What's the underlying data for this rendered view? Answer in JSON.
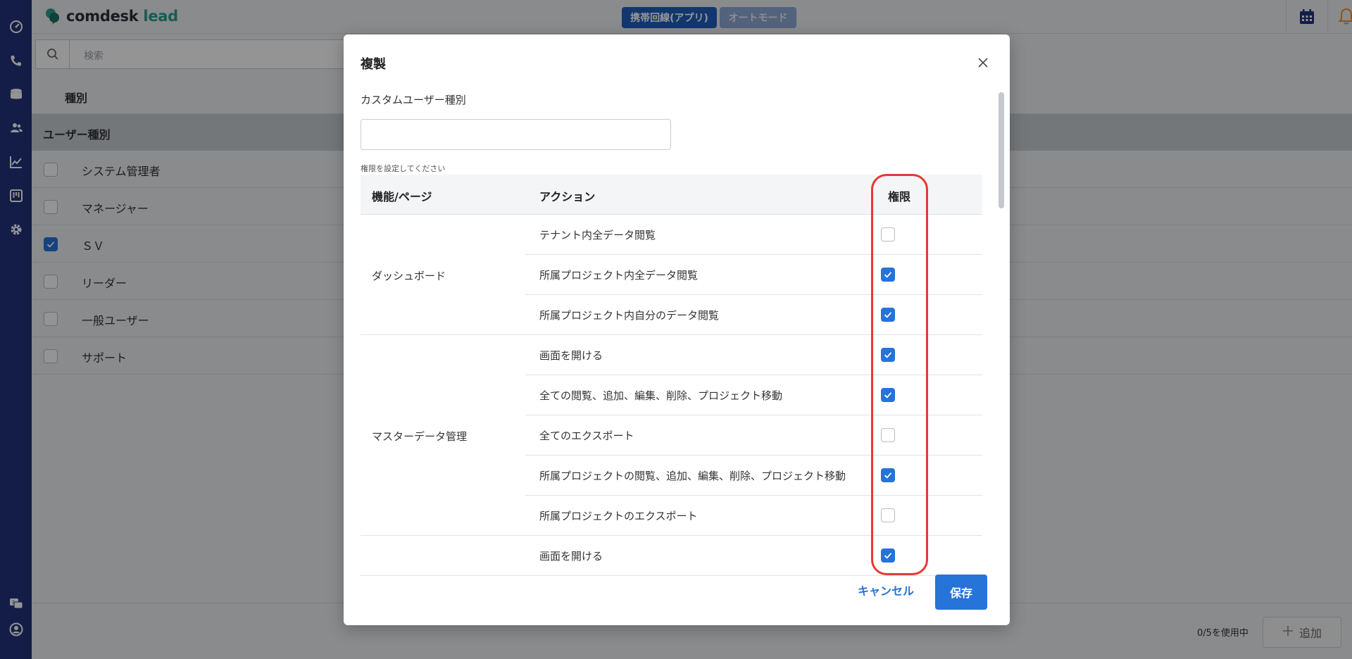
{
  "app": {
    "logo_brand": "comdesk",
    "logo_suffix": "lead"
  },
  "topbar": {
    "mode_primary": "携帯回線(アプリ)",
    "mode_secondary": "オートモード"
  },
  "search": {
    "placeholder": "検索"
  },
  "page": {
    "tab_label": "種別",
    "list_header": "ユーザー種別",
    "rows": [
      {
        "label": "システム管理者",
        "checked": false
      },
      {
        "label": "マネージャー",
        "checked": false
      },
      {
        "label": "ＳＶ",
        "checked": true
      },
      {
        "label": "リーダー",
        "checked": false
      },
      {
        "label": "一般ユーザー",
        "checked": false
      },
      {
        "label": "サポート",
        "checked": false
      }
    ],
    "usage": "0/5を使用中",
    "add_label": "追加"
  },
  "modal": {
    "title": "複製",
    "field_label": "カスタムユーザー種別",
    "field_value": "",
    "hint": "権限を設定してください",
    "columns": [
      "機能/ページ",
      "アクション",
      "権限"
    ],
    "groups": [
      {
        "name": "ダッシュボード",
        "actions": [
          {
            "label": "テナント内全データ閲覧",
            "checked": false
          },
          {
            "label": "所属プロジェクト内全データ閲覧",
            "checked": true
          },
          {
            "label": "所属プロジェクト内自分のデータ閲覧",
            "checked": true
          }
        ]
      },
      {
        "name": "マスターデータ管理",
        "actions": [
          {
            "label": "画面を開ける",
            "checked": true
          },
          {
            "label": "全ての閲覧、追加、編集、削除、プロジェクト移動",
            "checked": true
          },
          {
            "label": "全てのエクスポート",
            "checked": false
          },
          {
            "label": "所属プロジェクトの閲覧、追加、編集、削除、プロジェクト移動",
            "checked": true
          },
          {
            "label": "所属プロジェクトのエクスポート",
            "checked": false
          }
        ]
      },
      {
        "name": "",
        "actions": [
          {
            "label": "画面を開ける",
            "checked": true
          }
        ]
      }
    ],
    "cancel_label": "キャンセル",
    "save_label": "保存"
  },
  "colors": {
    "rail": "#22337a",
    "primary": "#2673d9",
    "highlight": "#e53935"
  },
  "icons": {
    "rail": [
      "dashboard-icon",
      "phone-icon",
      "database-icon",
      "users-icon",
      "chart-icon",
      "kanban-icon",
      "settings-icon",
      "help-chat-icon",
      "account-icon"
    ],
    "topbar": [
      "calendar-icon",
      "bell-icon"
    ]
  }
}
